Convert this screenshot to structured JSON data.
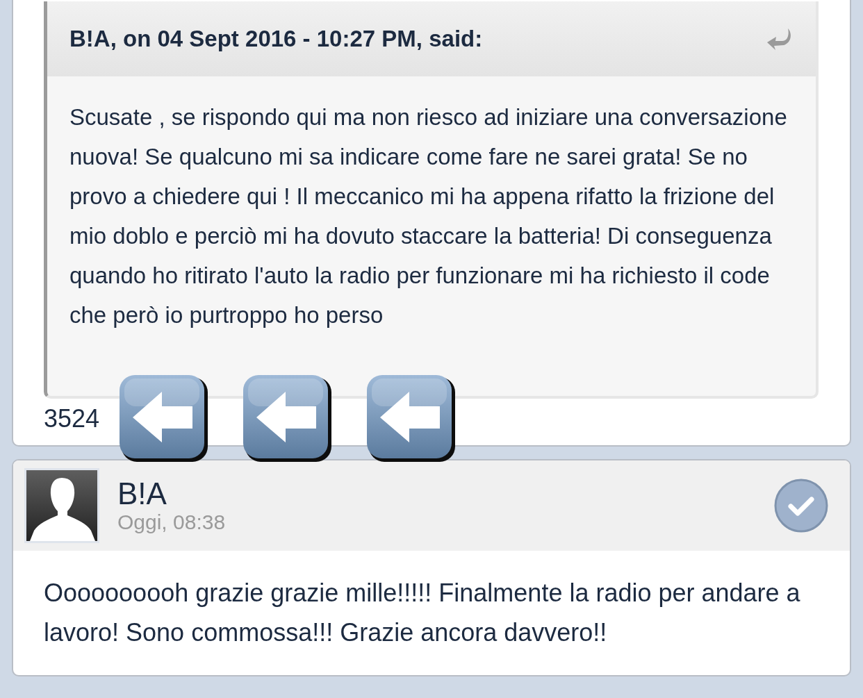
{
  "quote": {
    "citation": "B!A, on 04 Sept 2016 - 10:27 PM, said:",
    "text": "Scusate , se rispondo qui ma non riesco ad iniziare una conversazione nuova! Se qualcuno mi sa indicare come fare ne sarei grata! Se no provo a chiedere qui ! Il meccanico mi ha appena rifatto la frizione del mio doblo e perciò mi ha dovuto staccare la batteria! Di conseguenza quando ho ritirato l'auto la radio per funzionare mi ha richiesto il code che però io purtroppo ho perso"
  },
  "reply_text": "3524",
  "reply_icons": [
    {
      "kind": "left-arrow"
    },
    {
      "kind": "left-arrow"
    },
    {
      "kind": "left-arrow"
    }
  ],
  "post": {
    "author": "B!A",
    "time": "Oggi, 08:38",
    "selected": false,
    "text": "Oooooooooh grazie grazie mille!!!!! Finalmente la radio per andare a lavoro! Sono commossa!!! Grazie ancora davvero!!"
  }
}
